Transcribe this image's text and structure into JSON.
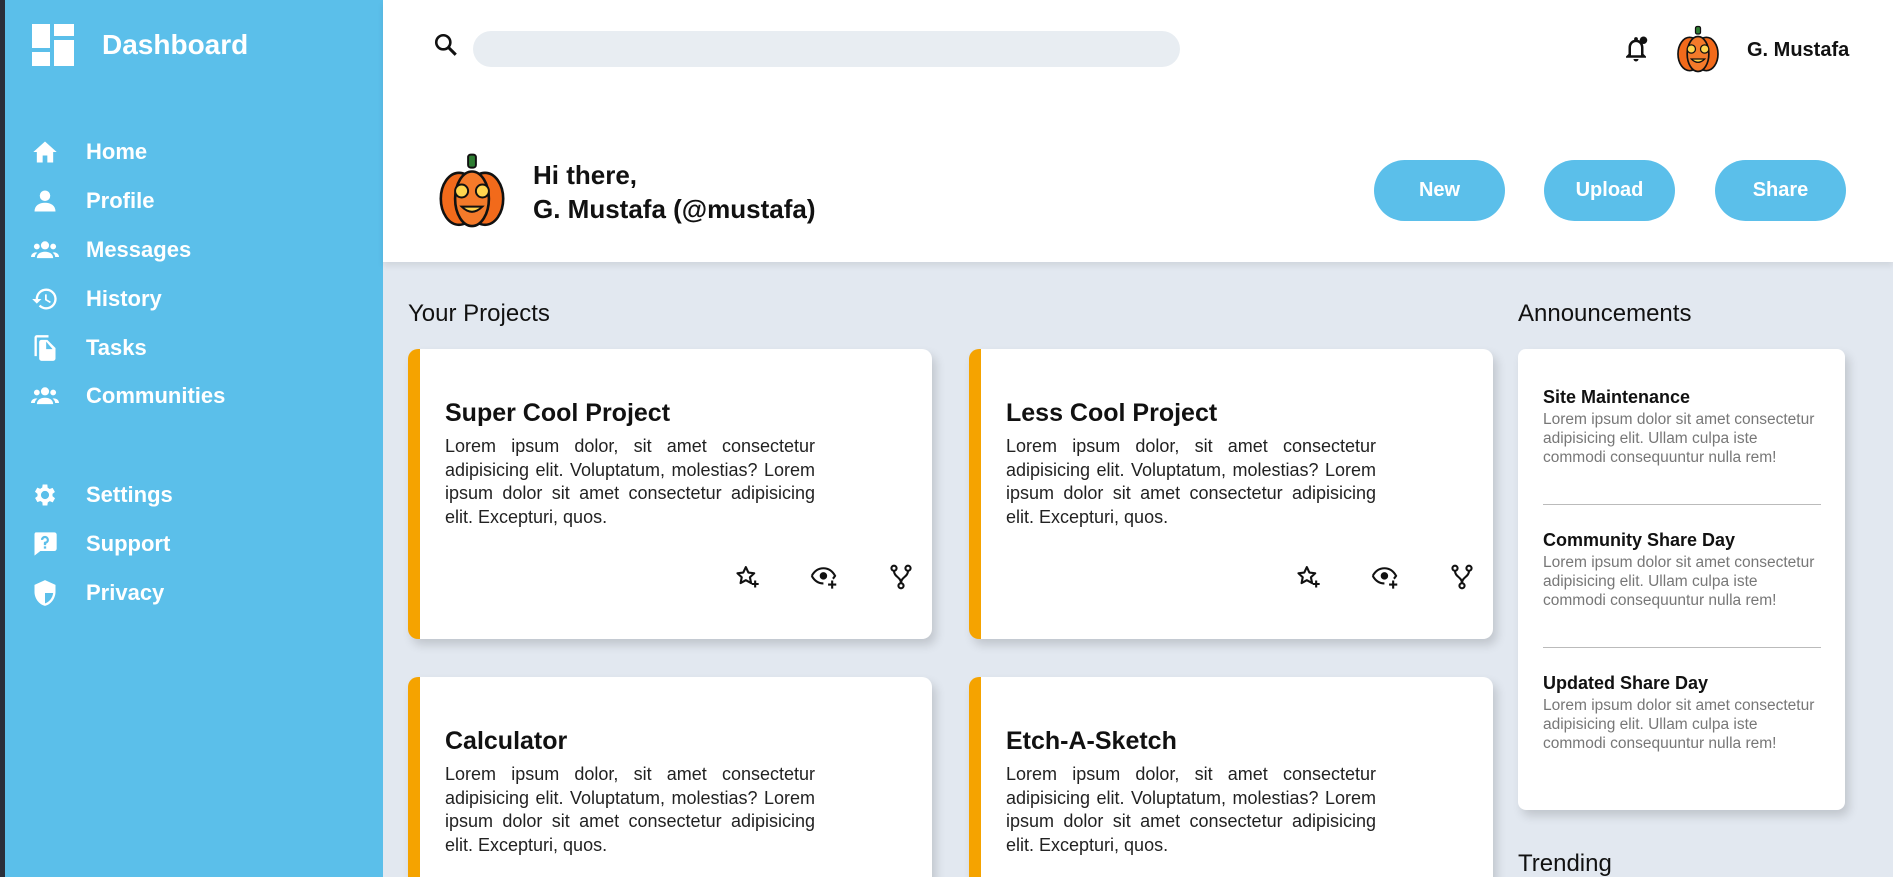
{
  "sidebar": {
    "brand": "Dashboard",
    "nav": [
      {
        "label": "Home",
        "icon": "home-icon"
      },
      {
        "label": "Profile",
        "icon": "profile-icon"
      },
      {
        "label": "Messages",
        "icon": "messages-icon"
      },
      {
        "label": "History",
        "icon": "history-icon"
      },
      {
        "label": "Tasks",
        "icon": "tasks-icon"
      },
      {
        "label": "Communities",
        "icon": "communities-icon"
      }
    ],
    "nav2": [
      {
        "label": "Settings",
        "icon": "settings-icon"
      },
      {
        "label": "Support",
        "icon": "support-icon"
      },
      {
        "label": "Privacy",
        "icon": "privacy-icon"
      }
    ]
  },
  "header": {
    "search_placeholder": "",
    "user_name": "G. Mustafa",
    "greeting_line1": "Hi there,",
    "greeting_line2": "G. Mustafa (@mustafa)",
    "buttons": {
      "new": "New",
      "upload": "Upload",
      "share": "Share"
    }
  },
  "projects": {
    "heading": "Your Projects",
    "items": [
      {
        "title": "Super Cool Project",
        "desc": "Lorem ipsum dolor, sit amet consectetur adipisicing elit. Voluptatum, molestias? Lorem ipsum dolor sit amet consectetur adipisicing elit. Excepturi, quos."
      },
      {
        "title": "Less Cool Project",
        "desc": "Lorem ipsum dolor, sit amet consectetur adipisicing elit. Voluptatum, molestias? Lorem ipsum dolor sit amet consectetur adipisicing elit. Excepturi, quos."
      },
      {
        "title": "Calculator",
        "desc": "Lorem ipsum dolor, sit amet consectetur adipisicing elit. Voluptatum, molestias? Lorem ipsum dolor sit amet consectetur adipisicing elit. Excepturi, quos."
      },
      {
        "title": "Etch-A-Sketch",
        "desc": "Lorem ipsum dolor, sit amet consectetur adipisicing elit. Voluptatum, molestias? Lorem ipsum dolor sit amet consectetur adipisicing elit. Excepturi, quos."
      }
    ]
  },
  "announcements": {
    "heading": "Announcements",
    "items": [
      {
        "title": "Site Maintenance",
        "body": "Lorem ipsum dolor sit amet consectetur adipisicing elit. Ullam culpa iste commodi consequuntur nulla rem!"
      },
      {
        "title": "Community Share Day",
        "body": "Lorem ipsum dolor sit amet consectetur adipisicing elit. Ullam culpa iste commodi consequuntur nulla rem!"
      },
      {
        "title": "Updated Share Day",
        "body": "Lorem ipsum dolor sit amet consectetur adipisicing elit. Ullam culpa iste commodi consequuntur nulla rem!"
      }
    ]
  },
  "trending": {
    "heading": "Trending"
  },
  "colors": {
    "sidebar": "#5bbfea",
    "accent": "#f5a300",
    "background": "#e2e8f0"
  }
}
